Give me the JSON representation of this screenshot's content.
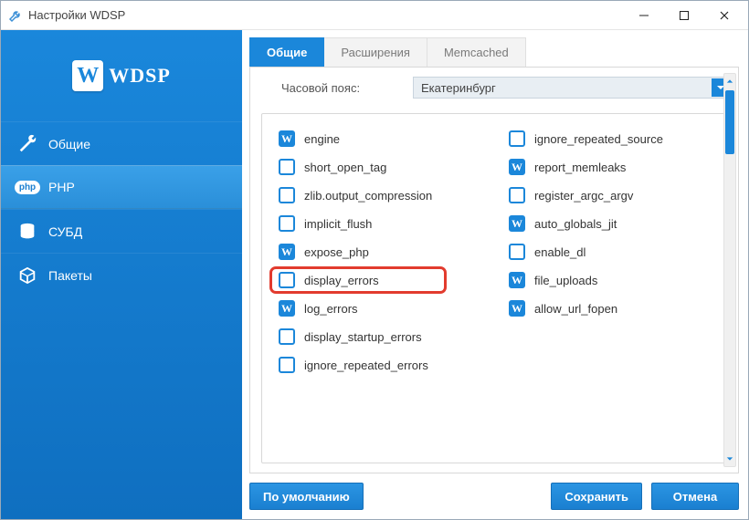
{
  "window": {
    "title": "Настройки WDSP"
  },
  "logo": {
    "badge": "W",
    "text": "WDSP"
  },
  "sidebar": {
    "items": [
      {
        "label": "Общие"
      },
      {
        "label": "PHP"
      },
      {
        "label": "СУБД"
      },
      {
        "label": "Пакеты"
      }
    ]
  },
  "tabs": [
    {
      "label": "Общие",
      "active": true
    },
    {
      "label": "Расширения",
      "active": false
    },
    {
      "label": "Memcached",
      "active": false
    }
  ],
  "timezone": {
    "label": "Часовой пояс:",
    "value": "Екатеринбург"
  },
  "options": {
    "left": [
      {
        "name": "engine",
        "checked": true
      },
      {
        "name": "short_open_tag",
        "checked": false
      },
      {
        "name": "zlib.output_compression",
        "checked": false
      },
      {
        "name": "implicit_flush",
        "checked": false
      },
      {
        "name": "expose_php",
        "checked": true
      },
      {
        "name": "display_errors",
        "checked": false,
        "highlight": true
      },
      {
        "name": "log_errors",
        "checked": true
      },
      {
        "name": "display_startup_errors",
        "checked": false
      },
      {
        "name": "ignore_repeated_errors",
        "checked": false
      }
    ],
    "right": [
      {
        "name": "ignore_repeated_source",
        "checked": false
      },
      {
        "name": "report_memleaks",
        "checked": true
      },
      {
        "name": "register_argc_argv",
        "checked": false
      },
      {
        "name": "auto_globals_jit",
        "checked": true
      },
      {
        "name": "enable_dl",
        "checked": false
      },
      {
        "name": "file_uploads",
        "checked": true
      },
      {
        "name": "allow_url_fopen",
        "checked": true
      }
    ]
  },
  "buttons": {
    "default": "По умолчанию",
    "save": "Сохранить",
    "cancel": "Отмена"
  }
}
